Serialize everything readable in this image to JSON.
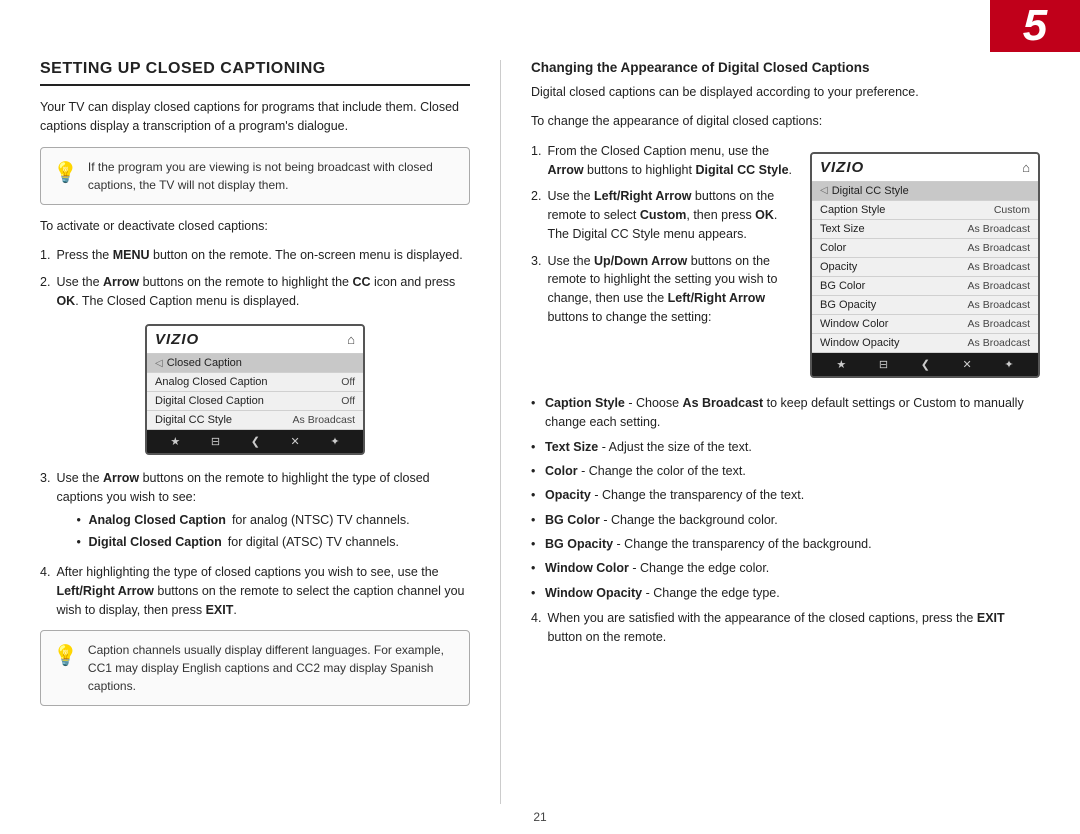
{
  "topBar": {
    "number": "5"
  },
  "leftCol": {
    "sectionTitle": "SETTING UP CLOSED CAPTIONING",
    "introParagraph": "Your TV can display closed captions for programs that include them. Closed captions display a transcription of a program's dialogue.",
    "infoBox": {
      "text": "If the program you are viewing is not being broadcast with closed captions, the TV will not display them."
    },
    "activateParagraph": "To activate or deactivate closed captions:",
    "steps": [
      {
        "num": "1.",
        "text": "Press the <b>MENU</b> button on the remote. The on-screen menu is displayed."
      },
      {
        "num": "2.",
        "text": "Use the <b>Arrow</b> buttons on the remote to highlight the <b>CC</b> icon and press <b>OK</b>. The Closed Caption menu is displayed."
      },
      {
        "num": "3.",
        "text": "Use the <b>Arrow</b> buttons on the remote to highlight the type of closed captions you wish to see:"
      },
      {
        "num": "4.",
        "text": "After highlighting the type of closed captions you wish to see, use the <b>Left/Right Arrow</b> buttons on the remote to select the caption channel you wish to display, then press <b>EXIT</b>."
      }
    ],
    "step3Bullets": [
      "<b>Analog Closed Caption</b> for analog (NTSC) TV channels.",
      "<b>Digital Closed Caption</b> for digital (ATSC) TV channels."
    ],
    "bottomNote": {
      "text": "Caption channels usually display different languages. For example, CC1 may display English captions and CC2 may display Spanish captions."
    },
    "tv": {
      "logo": "VIZIO",
      "menuTitle": "Closed Caption",
      "rows": [
        {
          "label": "Analog Closed Caption",
          "value": "Off"
        },
        {
          "label": "Digital Closed Caption",
          "value": "Off"
        },
        {
          "label": "Digital CC Style",
          "value": "As Broadcast"
        }
      ],
      "footerBtns": [
        "★",
        "⊟",
        "⌄",
        "✕",
        "✦"
      ]
    }
  },
  "rightCol": {
    "heading": "Changing the Appearance of Digital Closed Captions",
    "para1": "Digital closed captions can be displayed according to your preference.",
    "para2": "To change the appearance of digital closed captions:",
    "steps": [
      {
        "num": "1.",
        "text": "From the Closed Caption menu, use the <b>Arrow</b> buttons to highlight <b>Digital CC Style</b>."
      },
      {
        "num": "2.",
        "text": "Use the <b>Left/Right Arrow</b> buttons on the remote to select <b>Custom</b>, then press <b>OK</b>. The Digital CC Style menu appears."
      },
      {
        "num": "3.",
        "text": "Use the <b>Up/Down Arrow</b> buttons on the remote to highlight the setting you wish to change, then use the <b>Left/Right Arrow</b> buttons to change the setting:"
      },
      {
        "num": "4.",
        "text": "When you are satisfied with the appearance of the closed captions, press the <b>EXIT</b> button on the remote."
      }
    ],
    "step3Bullets": [
      "<b>Caption Style</b> - Choose <b>As Broadcast</b> to keep default settings or Custom to manually change each setting.",
      "<b>Text Size</b> - Adjust the size of the text.",
      "<b>Color</b> - Change the color of the text.",
      "<b>Opacity</b> - Change the transparency of the text.",
      "<b>BG Color</b> - Change the background color.",
      "<b>BG Opacity</b> - Change the transparency of the background.",
      "<b>Window Color</b> - Change the edge color.",
      "<b>Window Opacity</b> - Change the edge type."
    ],
    "tv": {
      "logo": "VIZIO",
      "menuTitle": "Digital CC Style",
      "rows": [
        {
          "label": "Caption Style",
          "value": "Custom"
        },
        {
          "label": "Text Size",
          "value": "As Broadcast"
        },
        {
          "label": "Color",
          "value": "As Broadcast"
        },
        {
          "label": "Opacity",
          "value": "As Broadcast"
        },
        {
          "label": "BG Color",
          "value": "As Broadcast"
        },
        {
          "label": "BG Opacity",
          "value": "As Broadcast"
        },
        {
          "label": "Window Color",
          "value": "As Broadcast"
        },
        {
          "label": "Window Opacity",
          "value": "As Broadcast"
        }
      ],
      "footerBtns": [
        "★",
        "⊟",
        "⌄",
        "✕",
        "✦"
      ]
    }
  },
  "pageNumber": "21"
}
